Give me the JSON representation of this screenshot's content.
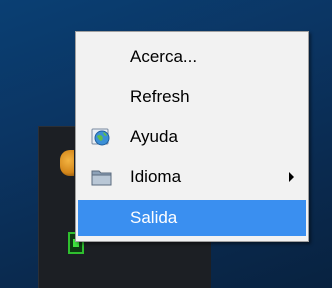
{
  "menu": {
    "items": [
      {
        "label": "Acerca...",
        "icon": null,
        "submenu": false,
        "selected": false
      },
      {
        "label": "Refresh",
        "icon": null,
        "submenu": false,
        "selected": false
      },
      {
        "label": "Ayuda",
        "icon": "help-globe-icon",
        "submenu": false,
        "selected": false
      },
      {
        "label": "Idioma",
        "icon": "folder-icon",
        "submenu": true,
        "selected": false
      },
      {
        "label": "Salida",
        "icon": null,
        "submenu": false,
        "selected": true
      }
    ],
    "colors": {
      "menu_background": "#f2f2f2",
      "selected_background": "#3a8ff0",
      "selected_text": "#ffffff"
    }
  }
}
